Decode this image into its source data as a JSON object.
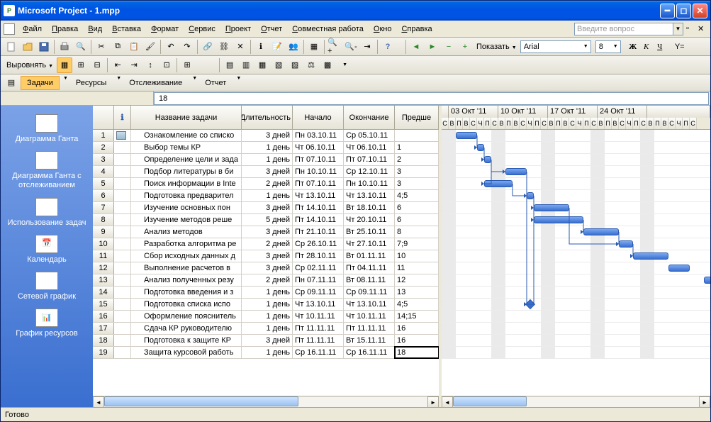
{
  "window": {
    "title": "Microsoft Project - 1.mpp"
  },
  "menu": [
    "Файл",
    "Правка",
    "Вид",
    "Вставка",
    "Формат",
    "Сервис",
    "Проект",
    "Отчет",
    "Совместная работа",
    "Окно",
    "Справка"
  ],
  "question_placeholder": "Введите вопрос",
  "toolbar2": {
    "show": "Показать",
    "font": "Arial",
    "size": "8"
  },
  "align_label": "Выровнять",
  "tabs": [
    "Задачи",
    "Ресурсы",
    "Отслеживание",
    "Отчет"
  ],
  "cell_value": "18",
  "side_items": [
    "Диаграмма Ганта",
    "Диаграмма Ганта с отслеживанием",
    "Использование задач",
    "Календарь",
    "Сетевой график",
    "График ресурсов"
  ],
  "columns": {
    "info": "ℹ",
    "name": "Название задачи",
    "dur": "Длительность",
    "start": "Начало",
    "end": "Окончание",
    "pred": "Предше"
  },
  "weeks": [
    "03 Окт '11",
    "10 Окт '11",
    "17 Окт '11",
    "24 Окт '11"
  ],
  "days": [
    "В",
    "П",
    "В",
    "С",
    "Ч",
    "П",
    "С"
  ],
  "tasks": [
    {
      "n": 1,
      "i": "t",
      "name": "Ознакомление со списко",
      "dur": "3 дней",
      "s": "Пн 03.10.11",
      "e": "Ср 05.10.11",
      "p": "",
      "bx": 20,
      "bw": 30
    },
    {
      "n": 2,
      "i": "",
      "name": "Выбор темы КР",
      "dur": "1 день",
      "s": "Чт 06.10.11",
      "e": "Чт 06.10.11",
      "p": "1",
      "bx": 50,
      "bw": 10
    },
    {
      "n": 3,
      "i": "",
      "name": "Определение цели и зада",
      "dur": "1 день",
      "s": "Пт 07.10.11",
      "e": "Пт 07.10.11",
      "p": "2",
      "bx": 60,
      "bw": 10
    },
    {
      "n": 4,
      "i": "",
      "name": "Подбор литературы в би",
      "dur": "3 дней",
      "s": "Пн 10.10.11",
      "e": "Ср 12.10.11",
      "p": "3",
      "bx": 90,
      "bw": 30
    },
    {
      "n": 5,
      "i": "",
      "name": "Поиск информации в Inte",
      "dur": "2 дней",
      "s": "Пт 07.10.11",
      "e": "Пн 10.10.11",
      "p": "3",
      "bx": 60,
      "bw": 40
    },
    {
      "n": 6,
      "i": "",
      "name": "Подготовка предварител",
      "dur": "1 день",
      "s": "Чт 13.10.11",
      "e": "Чт 13.10.11",
      "p": "4;5",
      "bx": 120,
      "bw": 10
    },
    {
      "n": 7,
      "i": "",
      "name": "Изучение основных пон",
      "dur": "3 дней",
      "s": "Пт 14.10.11",
      "e": "Вт 18.10.11",
      "p": "6",
      "bx": 130,
      "bw": 50
    },
    {
      "n": 8,
      "i": "",
      "name": "Изучение методов реше",
      "dur": "5 дней",
      "s": "Пт 14.10.11",
      "e": "Чт 20.10.11",
      "p": "6",
      "bx": 130,
      "bw": 70
    },
    {
      "n": 9,
      "i": "",
      "name": "Анализ методов",
      "dur": "3 дней",
      "s": "Пт 21.10.11",
      "e": "Вт 25.10.11",
      "p": "8",
      "bx": 200,
      "bw": 50
    },
    {
      "n": 10,
      "i": "",
      "name": "Разработка алгоритма ре",
      "dur": "2 дней",
      "s": "Ср 26.10.11",
      "e": "Чт 27.10.11",
      "p": "7;9",
      "bx": 250,
      "bw": 20
    },
    {
      "n": 11,
      "i": "",
      "name": "Сбор исходных данных д",
      "dur": "3 дней",
      "s": "Пт 28.10.11",
      "e": "Вт 01.11.11",
      "p": "10",
      "bx": 270,
      "bw": 50
    },
    {
      "n": 12,
      "i": "",
      "name": "Выполнение расчетов в",
      "dur": "3 дней",
      "s": "Ср 02.11.11",
      "e": "Пт 04.11.11",
      "p": "11",
      "bx": 320,
      "bw": 30
    },
    {
      "n": 13,
      "i": "",
      "name": "Анализ полученных резу",
      "dur": "2 дней",
      "s": "Пн 07.11.11",
      "e": "Вт 08.11.11",
      "p": "12",
      "bx": 370,
      "bw": 20
    },
    {
      "n": 14,
      "i": "",
      "name": "Подготовка введения и з",
      "dur": "1 день",
      "s": "Ср 09.11.11",
      "e": "Ср 09.11.11",
      "p": "13",
      "bx": 390,
      "bw": 10
    },
    {
      "n": 15,
      "i": "",
      "name": "Подготовка списка испо",
      "dur": "1 день",
      "s": "Чт 13.10.11",
      "e": "Чт 13.10.11",
      "p": "4;5",
      "bx": 120,
      "bw": 0
    },
    {
      "n": 16,
      "i": "",
      "name": "Оформление пояснитель",
      "dur": "1 день",
      "s": "Чт 10.11.11",
      "e": "Чт 10.11.11",
      "p": "14;15",
      "bx": 400,
      "bw": 10
    },
    {
      "n": 17,
      "i": "",
      "name": "Сдача КР руководителю",
      "dur": "1 день",
      "s": "Пт 11.11.11",
      "e": "Пт 11.11.11",
      "p": "16",
      "bx": 410,
      "bw": 10
    },
    {
      "n": 18,
      "i": "",
      "name": "Подготовка к защите КР",
      "dur": "3 дней",
      "s": "Пт 11.11.11",
      "e": "Вт 15.11.11",
      "p": "16",
      "bx": 410,
      "bw": 50
    },
    {
      "n": 19,
      "i": "",
      "name": "Защита курсовой работь",
      "dur": "1 день",
      "s": "Ср 16.11.11",
      "e": "Ср 16.11.11",
      "p": "18",
      "bx": 460,
      "bw": 10
    }
  ],
  "status": "Готово",
  "chart_data": {
    "type": "gantt",
    "time_axis": {
      "start": "2011-10-02",
      "end": "2011-10-30",
      "unit": "day"
    },
    "tasks_ref": "see tasks[] array (n = row id, bx/bw = pixel offset/width on visible timeline)"
  }
}
